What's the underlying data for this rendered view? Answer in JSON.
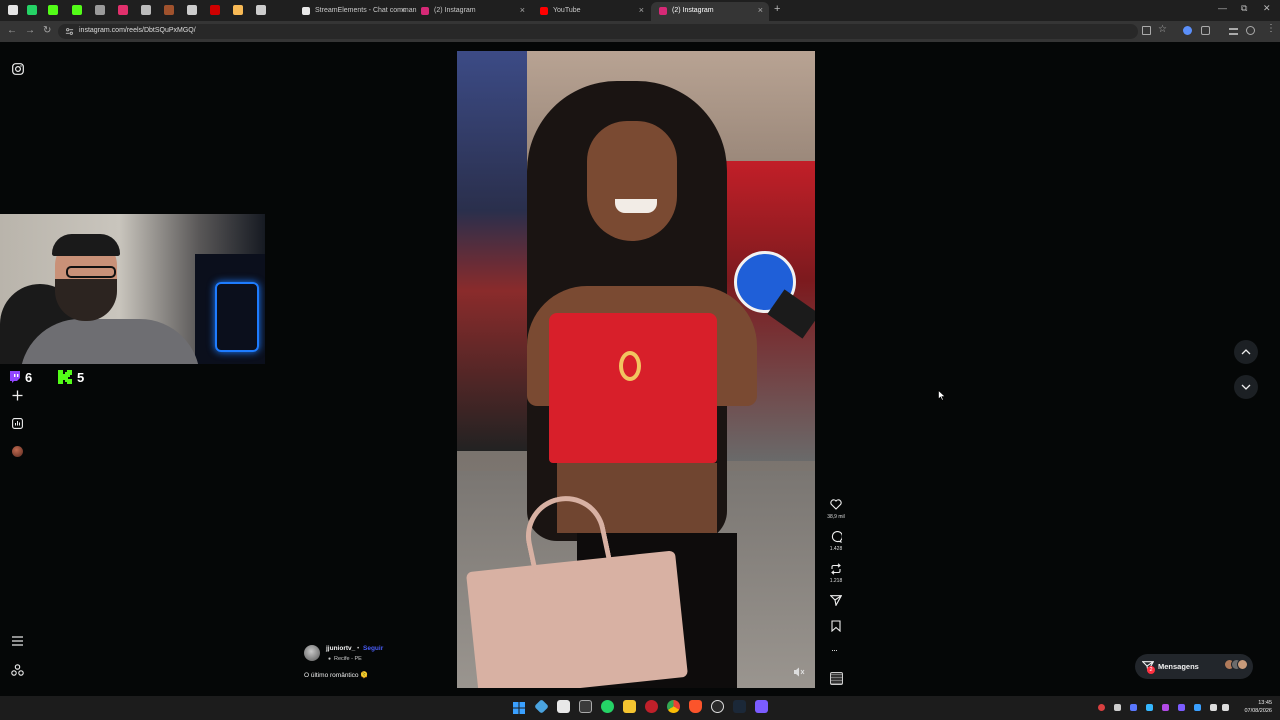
{
  "browser": {
    "tabs": [
      {
        "title": "StreamElements - Chat comman",
        "color": "#e9e9e9"
      },
      {
        "title": "(2) Instagram",
        "color": "#d62976"
      },
      {
        "title": "YouTube",
        "color": "#ff0000"
      },
      {
        "title": "(2) Instagram",
        "color": "#d62976",
        "active": true
      }
    ],
    "pinned_favicons": [
      "#e5e5e5",
      "#25d366",
      "#53fc18",
      "#53fc18",
      "#9a9a9a",
      "#e1306c",
      "#bbbbbb",
      "#a0522d",
      "#cccccc",
      "#d00000",
      "#f7b955",
      "#cccccc"
    ],
    "new_tab": "+",
    "url": "instagram.com/reels/DbtSQuPxMGQ/",
    "window_controls": [
      "—",
      "⧉",
      "✕"
    ]
  },
  "sidebar": {
    "icons": [
      "instagram-logo-icon",
      "plus-icon",
      "chart-icon",
      "avatar-icon",
      "menu-icon",
      "meta-icon"
    ]
  },
  "overlay": {
    "twitch_count": "6",
    "kick_count": "5"
  },
  "reel": {
    "username": "jjuniortv_",
    "follow_label": "Seguir",
    "location": "Recife - PE",
    "caption": "O último romântico 🫠",
    "likes": "38,9 mil",
    "comments": "1.428",
    "reposts": "1.218"
  },
  "messages": {
    "label": "Mensagens",
    "badge": "2"
  },
  "taskbar": {
    "time": "13:45",
    "date": "07/08/2026"
  },
  "colors": {
    "instagram_blue": "#4a5df9",
    "kick_green": "#53fc18",
    "twitch_purple": "#9146ff",
    "red_top": "#d81f2a"
  }
}
